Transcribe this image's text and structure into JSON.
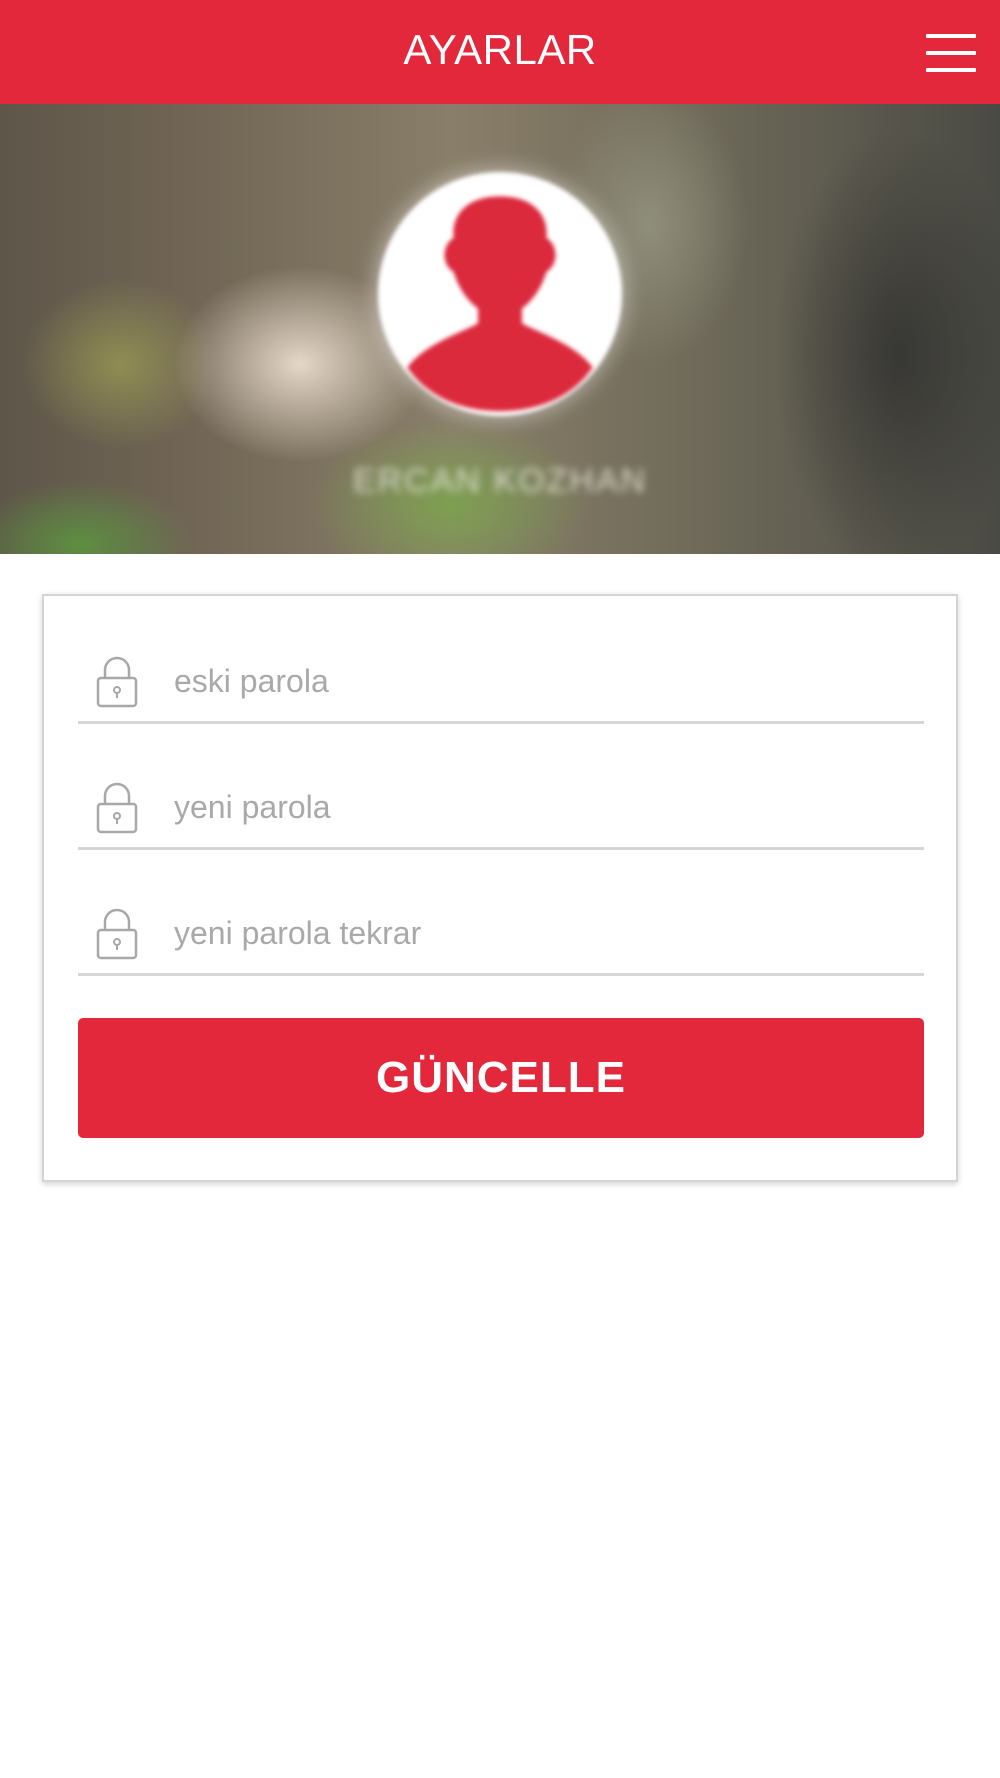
{
  "header": {
    "title": "AYARLAR",
    "menu_icon": "hamburger-menu-icon"
  },
  "profile": {
    "avatar_icon": "user-silhouette-icon",
    "name": "ERCAN KOZHAN"
  },
  "form": {
    "fields": [
      {
        "placeholder": "eski parola",
        "icon": "lock-icon",
        "type": "password"
      },
      {
        "placeholder": "yeni parola",
        "icon": "lock-icon",
        "type": "password"
      },
      {
        "placeholder": "yeni parola tekrar",
        "icon": "lock-icon",
        "type": "password"
      }
    ],
    "submit_label": "GÜNCELLE"
  },
  "colors": {
    "accent": "#e3283c",
    "field_underline": "#d6d6d6",
    "placeholder": "#a9a9a9"
  }
}
